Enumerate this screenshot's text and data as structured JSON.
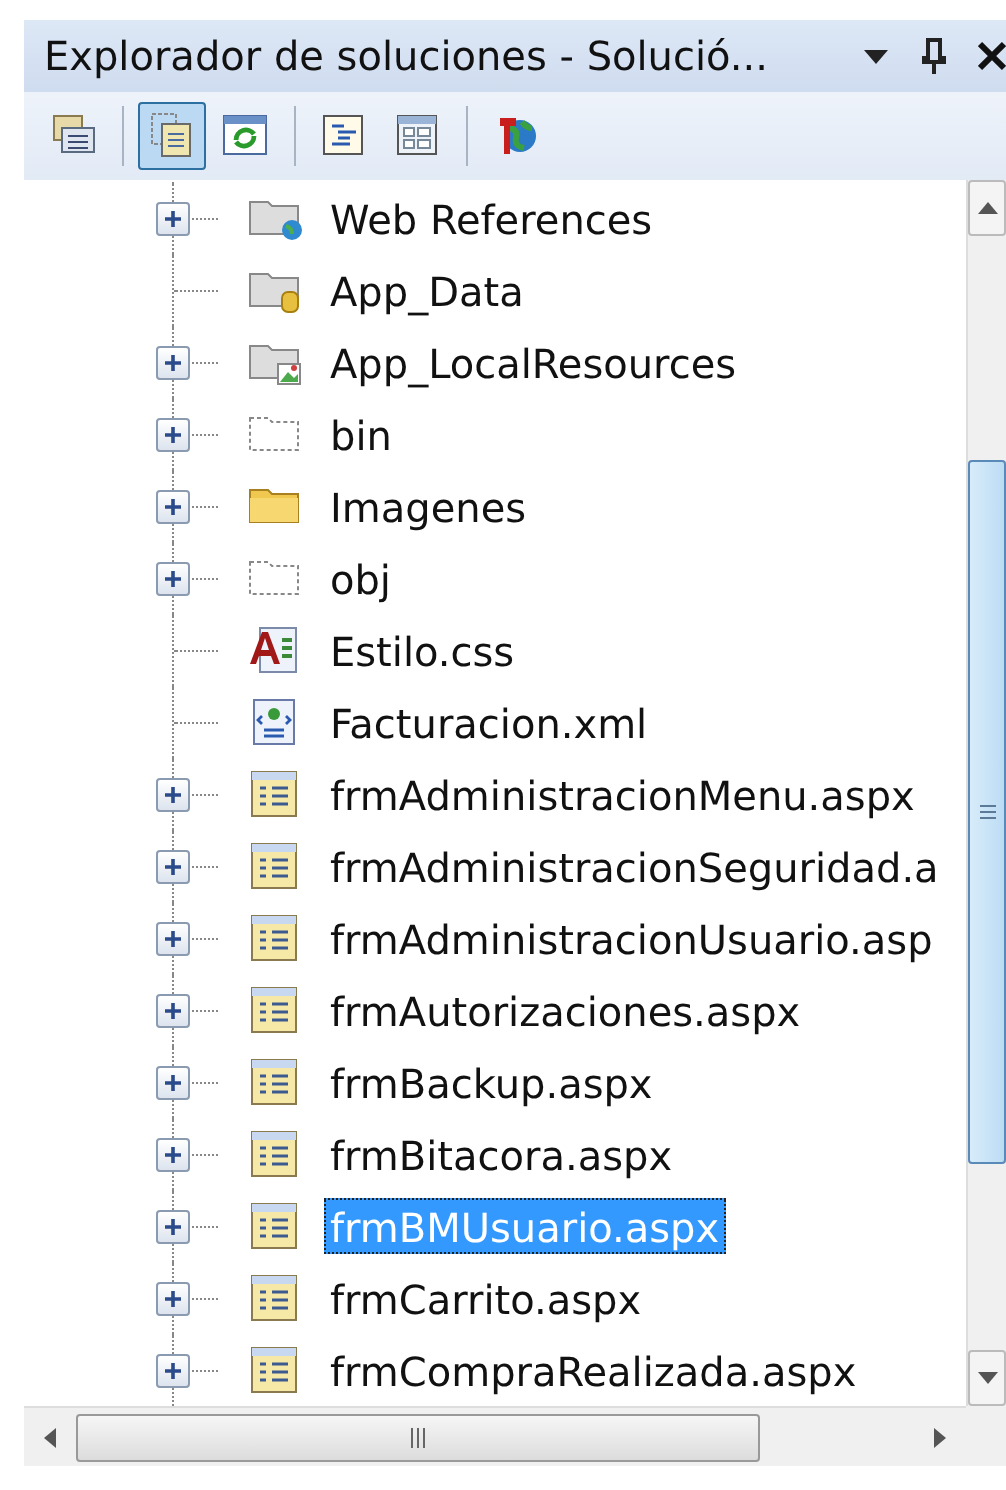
{
  "window": {
    "title": "Explorador de soluciones - Solució..."
  },
  "toolbar": [
    {
      "kind": "properties",
      "pressed": false
    },
    {
      "kind": "separator"
    },
    {
      "kind": "show-all",
      "pressed": true
    },
    {
      "kind": "refresh",
      "pressed": false
    },
    {
      "kind": "separator"
    },
    {
      "kind": "view-code",
      "pressed": false
    },
    {
      "kind": "view-designer",
      "pressed": false
    },
    {
      "kind": "separator"
    },
    {
      "kind": "web-config",
      "pressed": false
    }
  ],
  "tree": {
    "items": [
      {
        "kind": "folder-web",
        "label": "Web References",
        "expandable": true,
        "selected": false
      },
      {
        "kind": "folder-data",
        "label": "App_Data",
        "expandable": false,
        "selected": false
      },
      {
        "kind": "folder-resources",
        "label": "App_LocalResources",
        "expandable": true,
        "selected": false
      },
      {
        "kind": "folder-hidden",
        "label": "bin",
        "expandable": true,
        "selected": false
      },
      {
        "kind": "folder",
        "label": "Imagenes",
        "expandable": true,
        "selected": false
      },
      {
        "kind": "folder-hidden",
        "label": "obj",
        "expandable": true,
        "selected": false
      },
      {
        "kind": "css",
        "label": "Estilo.css",
        "expandable": false,
        "selected": false
      },
      {
        "kind": "xml",
        "label": "Facturacion.xml",
        "expandable": false,
        "selected": false
      },
      {
        "kind": "aspx",
        "label": "frmAdministracionMenu.aspx",
        "expandable": true,
        "selected": false
      },
      {
        "kind": "aspx",
        "label": "frmAdministracionSeguridad.a",
        "expandable": true,
        "selected": false
      },
      {
        "kind": "aspx",
        "label": "frmAdministracionUsuario.asp",
        "expandable": true,
        "selected": false
      },
      {
        "kind": "aspx",
        "label": "frmAutorizaciones.aspx",
        "expandable": true,
        "selected": false
      },
      {
        "kind": "aspx",
        "label": "frmBackup.aspx",
        "expandable": true,
        "selected": false
      },
      {
        "kind": "aspx",
        "label": "frmBitacora.aspx",
        "expandable": true,
        "selected": false
      },
      {
        "kind": "aspx",
        "label": "frmBMUsuario.aspx",
        "expandable": true,
        "selected": true
      },
      {
        "kind": "aspx",
        "label": "frmCarrito.aspx",
        "expandable": true,
        "selected": false
      },
      {
        "kind": "aspx",
        "label": "frmCompraRealizada.aspx",
        "expandable": true,
        "selected": false
      }
    ]
  }
}
